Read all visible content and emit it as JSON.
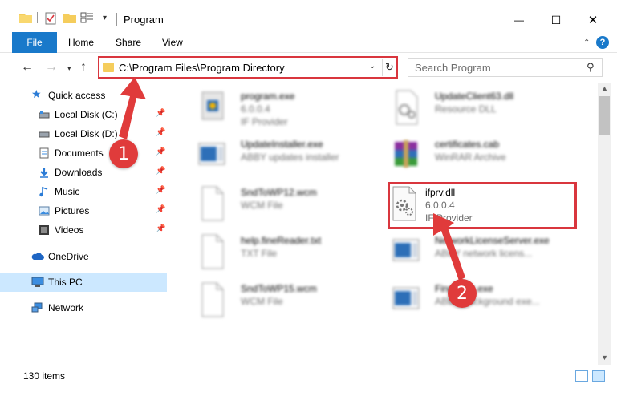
{
  "window": {
    "title": "Program",
    "minimize_glyph": "—",
    "maximize_glyph": "☐",
    "close_glyph": "✕"
  },
  "ribbon": {
    "tabs": [
      "File",
      "Home",
      "Share",
      "View"
    ],
    "help_label": "?"
  },
  "address": {
    "path": "C:\\Program Files\\Program Directory",
    "search_placeholder": "Search Program",
    "nav_back": "←",
    "nav_forward": "→",
    "nav_up": "↑",
    "refresh": "↻",
    "dropdown": "⌄"
  },
  "sidebar": {
    "quick_access": "Quick access",
    "items": [
      {
        "label": "Local Disk (C:)",
        "icon": "drive-icon"
      },
      {
        "label": "Local Disk (D:)",
        "icon": "drive-icon"
      },
      {
        "label": "Documents",
        "icon": "documents-icon"
      },
      {
        "label": "Downloads",
        "icon": "downloads-icon"
      },
      {
        "label": "Music",
        "icon": "music-icon"
      },
      {
        "label": "Pictures",
        "icon": "pictures-icon"
      },
      {
        "label": "Videos",
        "icon": "videos-icon"
      }
    ],
    "onedrive": "OneDrive",
    "this_pc": "This PC",
    "network": "Network"
  },
  "files": [
    {
      "name": "program.exe",
      "sub1": "6.0.0.4",
      "sub2": "IF Provider",
      "icon": "exe-icon"
    },
    {
      "name": "UpdateClient63.dll",
      "sub1": "Resource DLL",
      "sub2": "",
      "icon": "dll-icon"
    },
    {
      "name": "UpdateInstaller.exe",
      "sub1": "ABBY updates installer",
      "sub2": "",
      "icon": "installer-icon"
    },
    {
      "name": "certificates.cab",
      "sub1": "WinRAR Archive",
      "sub2": "",
      "icon": "archive-icon"
    },
    {
      "name": "SndToWP12.wcm",
      "sub1": "WCM File",
      "sub2": "",
      "icon": "file-icon"
    },
    {
      "name": "ifprv.dll",
      "sub1": "6.0.0.4",
      "sub2": "IF Provider",
      "icon": "dll-gear-icon"
    },
    {
      "name": "help.fineReader.txt",
      "sub1": "TXT File",
      "sub2": "",
      "icon": "file-icon"
    },
    {
      "name": "NetworkLicenseServer.exe",
      "sub1": "ABBY network licens...",
      "sub2": "",
      "icon": "installer-icon"
    },
    {
      "name": "SndToWP15.wcm",
      "sub1": "WCM File",
      "sub2": "",
      "icon": "file-icon"
    },
    {
      "name": "FineExec.exe",
      "sub1": "ABBY background exe...",
      "sub2": "",
      "icon": "installer-icon"
    }
  ],
  "status": {
    "item_count": "130 items"
  },
  "callouts": [
    "1",
    "2"
  ],
  "colors": {
    "accent": "#1979ca",
    "highlight": "#d9363e",
    "selected": "#cce8ff"
  }
}
